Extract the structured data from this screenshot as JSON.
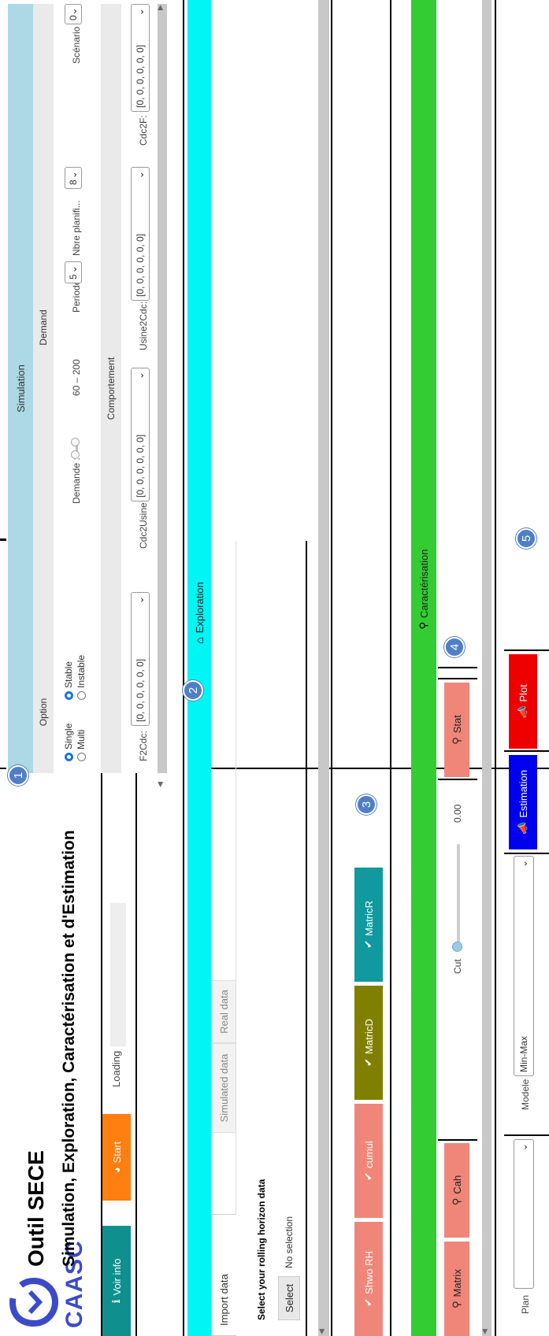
{
  "header": {
    "logo_text": "CAASC",
    "app_name": "Outil SECE",
    "subtitle": "Simulation, Exploration, Caractérisation et d'Estimation",
    "voir_info_label": "Voir info",
    "start_label": "Start",
    "loading_label": "Loading"
  },
  "badges": [
    "1",
    "2",
    "3",
    "4",
    "5"
  ],
  "simulation": {
    "title": "Simulation",
    "option_title": "Option",
    "demand_title": "Demand",
    "radio_single": "Single",
    "radio_multi": "Multi",
    "radio_stable": "Stable",
    "radio_instable": "Instable",
    "demande_label": "Demande :",
    "demande_range": "60 – 200",
    "periode_label": "Periode",
    "periode_value": "5",
    "nbre_label": "Nbre planifi...",
    "nbre_value": "8",
    "scenario_label": "Scénario",
    "scenario_value": "0",
    "comportement_title": "Comportement",
    "f2cdc_label": "F2Cdc:",
    "f2cdc_value": "[0, 0, 0, 0, 0, 0]",
    "cdc2usine_label": "Cdc2Usine:",
    "cdc2usine_value": "[0, 0, 0, 0, 0, 0]",
    "usine2cdc_label": "Usine2Cdc:",
    "usine2cdc_value": "[0, 0, 0, 0, 0, 0]",
    "cdc2f_label": "Cdc2F:",
    "cdc2f_value": "[0, 0, 0, 0, 0, 0]"
  },
  "import": {
    "tab_import": "Import data",
    "tab_simulated": "Simulated data",
    "tab_real": "Real data",
    "heading": "Select your rolling horizon data",
    "select_button": "Select",
    "no_selection": "No selection"
  },
  "exploration": {
    "title": "Exploration",
    "buttons": [
      "Shwo RH",
      "cumul",
      "MatricD",
      "MatricR"
    ],
    "colors": [
      "#f0867a",
      "#f0867a",
      "#808000",
      "#10999e"
    ]
  },
  "caracterisation": {
    "title": "Caractérisation",
    "matrix_label": "Matrix",
    "cah_label": "Cah",
    "cut_label": "Cut",
    "cut_value": "0.00",
    "stat_label": "Stat"
  },
  "estimation": {
    "plan_label": "Plan",
    "modele_label": "Modele",
    "modele_value": "Min-Max",
    "estimation_button": "Estimation",
    "plot_button": "Plot",
    "colors": {
      "estimation": "#0000ee",
      "plot": "#ee0000"
    }
  },
  "colors": {
    "cyan": "#00f5f5",
    "green": "#33cc33",
    "light_blue": "#add8e6",
    "orange": "#ff7f11",
    "teal": "#108f8f",
    "salmon": "#f0867a"
  }
}
